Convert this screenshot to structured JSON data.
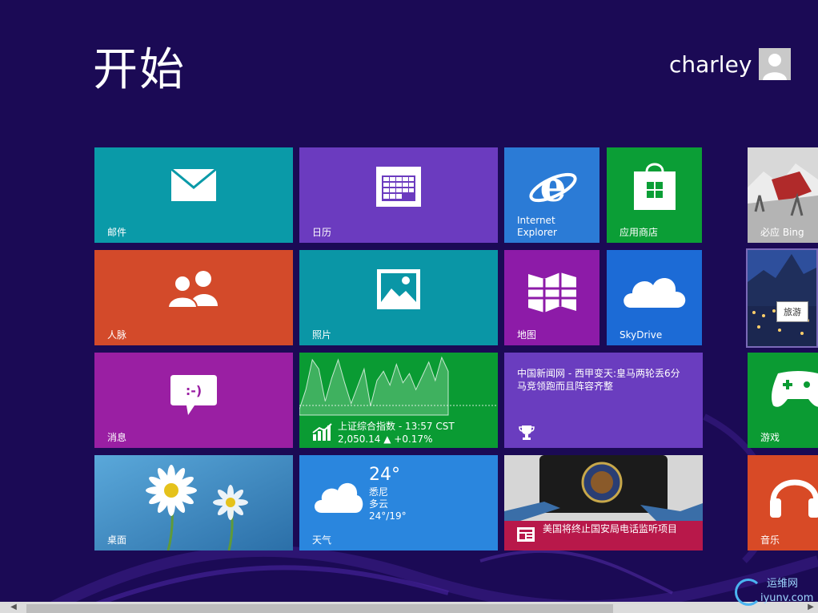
{
  "header": {
    "title": "开始",
    "user": "charley"
  },
  "tiles": {
    "mail": "邮件",
    "calendar": "日历",
    "ie": "Internet Explorer",
    "ie_line1": "Internet",
    "ie_line2": "Explorer",
    "store": "应用商店",
    "bing": "必应 Bing",
    "people": "人脉",
    "photos": "照片",
    "maps": "地图",
    "skydrive": "SkyDrive",
    "travel_tooltip": "旅游",
    "messaging": "消息",
    "messaging_glyph": ":-)",
    "finance_title": "上证综合指数 - 13:57 CST",
    "finance_value": "2,050.14 ▲ +0.17%",
    "news_text": "中国新闻网 - 西甲变天:皇马两轮丢6分 马竞领跑而且阵容齐整",
    "games": "游戏",
    "desktop": "桌面",
    "weather": "天气",
    "weather_temp": "24°",
    "weather_city": "悉尼",
    "weather_cond": "多云",
    "weather_range": "24°/19°",
    "news2_text": "美国将终止国安局电话监听项目",
    "music": "音乐"
  },
  "finance_chart": {
    "values": [
      5,
      22,
      48,
      40,
      12,
      32,
      48,
      28,
      10,
      25,
      40,
      8,
      30,
      38,
      26,
      44,
      28,
      36,
      22,
      34,
      46,
      30,
      50,
      38
    ]
  },
  "watermark": {
    "line1": "运维网",
    "line2": "iyunv.com"
  },
  "colors": {
    "background": "#1b0a55",
    "mail": "#0a9aa8",
    "calendar": "#6b3bbf",
    "ie": "#2b7bd6",
    "store": "#0b9e36",
    "people": "#d34a2a",
    "photos": "#0a96a6",
    "maps": "#8d1ba8",
    "skydrive": "#1c6bd6",
    "messaging": "#9a1fa3",
    "finance": "#0a9b33",
    "news": "#6a3dbf",
    "weather": "#2a86de",
    "news2_band": "#b8184a",
    "games": "#0b9b33",
    "music": "#d84a26"
  }
}
